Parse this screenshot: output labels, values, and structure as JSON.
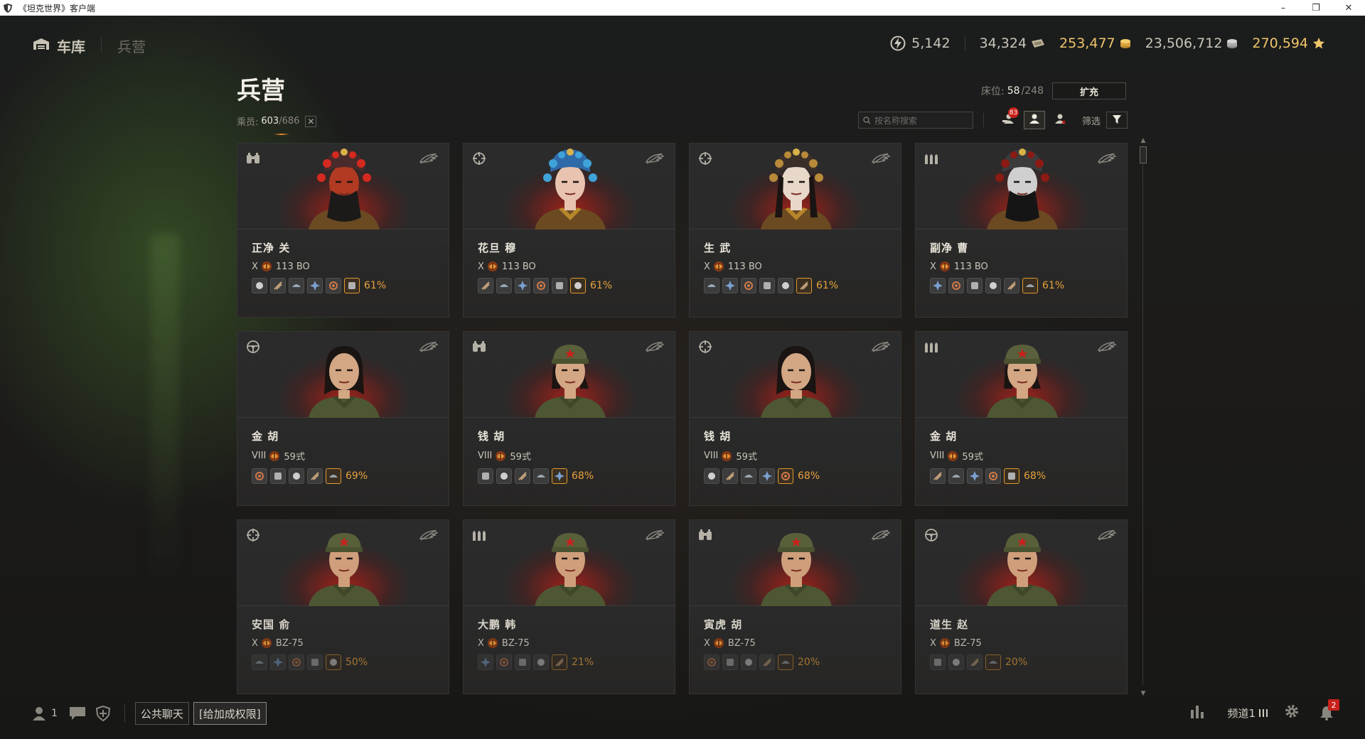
{
  "window": {
    "title": "《坦克世界》客户端",
    "controls": [
      "–",
      "❐",
      "✕"
    ]
  },
  "nav": {
    "garage_label": "车库",
    "barracks_label": "兵营"
  },
  "currencies": {
    "free_xp": "5,142",
    "bonds": "34,324",
    "gold": "253,477",
    "credits": "23,506,712",
    "crew_xp": "270,594"
  },
  "page": {
    "title": "兵营",
    "crew_label": "乘员:",
    "crew_count": "603",
    "crew_total": "/686",
    "clear_icon": "✕",
    "berths_label": "床位:",
    "berths_used": "58",
    "berths_total": "/248",
    "expand_label": "扩充",
    "search_placeholder": "按名称搜索",
    "badge_count": "83",
    "filter_label": "筛选"
  },
  "colors": {
    "accent": "#e8a23a",
    "badge": "#c8201b",
    "gold": "#f1c56b"
  },
  "crew": [
    {
      "name": "正净 关",
      "tier": "X",
      "vehicle": "113 BO",
      "role": "commander",
      "portrait": "opera-red",
      "skills": 6,
      "pct": "61%"
    },
    {
      "name": "花旦 穆",
      "tier": "X",
      "vehicle": "113 BO",
      "role": "gunner",
      "portrait": "opera-blue",
      "skills": 6,
      "pct": "61%"
    },
    {
      "name": "生 武",
      "tier": "X",
      "vehicle": "113 BO",
      "role": "gunner",
      "portrait": "opera-white",
      "skills": 6,
      "pct": "61%"
    },
    {
      "name": "副净 曹",
      "tier": "X",
      "vehicle": "113 BO",
      "role": "loader",
      "portrait": "opera-mask",
      "skills": 6,
      "pct": "61%"
    },
    {
      "name": "金 胡",
      "tier": "VIII",
      "vehicle": "59式",
      "role": "driver",
      "portrait": "female",
      "skills": 5,
      "pct": "69%"
    },
    {
      "name": "钱 胡",
      "tier": "VIII",
      "vehicle": "59式",
      "role": "commander",
      "portrait": "female-cap",
      "skills": 5,
      "pct": "68%"
    },
    {
      "name": "钱 胡",
      "tier": "VIII",
      "vehicle": "59式",
      "role": "gunner",
      "portrait": "female",
      "skills": 5,
      "pct": "68%"
    },
    {
      "name": "金 胡",
      "tier": "VIII",
      "vehicle": "59式",
      "role": "loader",
      "portrait": "female-cap",
      "skills": 5,
      "pct": "68%"
    },
    {
      "name": "安国 俞",
      "tier": "X",
      "vehicle": "BZ-75",
      "role": "gunner",
      "portrait": "male-cap",
      "skills": 5,
      "pct": "50%"
    },
    {
      "name": "大鹏 韩",
      "tier": "X",
      "vehicle": "BZ-75",
      "role": "loader",
      "portrait": "male-cap",
      "skills": 5,
      "pct": "21%"
    },
    {
      "name": "寅虎 胡",
      "tier": "X",
      "vehicle": "BZ-75",
      "role": "commander",
      "portrait": "male-cap",
      "skills": 5,
      "pct": "20%"
    },
    {
      "name": "道生 赵",
      "tier": "X",
      "vehicle": "BZ-75",
      "role": "driver",
      "portrait": "male-cap",
      "skills": 4,
      "pct": "20%"
    }
  ],
  "bottom": {
    "online_count": "1",
    "public_chat_label": "公共聊天",
    "permission_label": "[给加成权限]",
    "channel_label": "频道1",
    "notif_count": "2"
  }
}
